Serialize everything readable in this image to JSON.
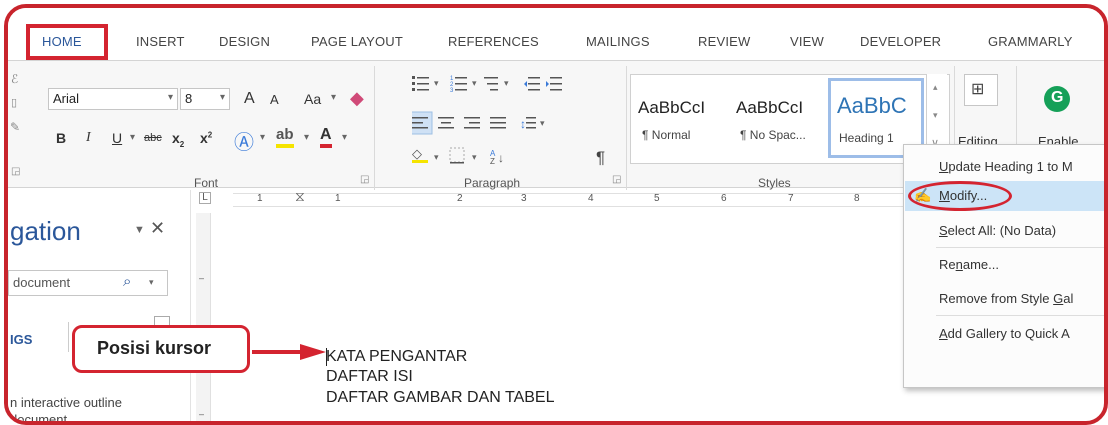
{
  "tabs": [
    "HOME",
    "INSERT",
    "DESIGN",
    "PAGE LAYOUT",
    "REFERENCES",
    "MAILINGS",
    "REVIEW",
    "VIEW",
    "DEVELOPER",
    "GRAMMARLY"
  ],
  "font": {
    "name": "Arial",
    "size": "8",
    "grow": "A",
    "shrink": "A",
    "case": "Aa",
    "bold": "B",
    "italic": "I",
    "underline": "U",
    "strike": "abc",
    "sub": "x",
    "sup": "x",
    "group_label": "Font"
  },
  "paragraph": {
    "group_label": "Paragraph",
    "pilcrow": "¶"
  },
  "styles": {
    "group_label": "Styles",
    "items": [
      {
        "sample": "AaBbCcI",
        "name": "¶ Normal"
      },
      {
        "sample": "AaBbCcI",
        "name": "¶ No Spac..."
      },
      {
        "sample": "AaBbC",
        "name": "Heading 1"
      }
    ]
  },
  "editing": {
    "label": "Editing"
  },
  "grammarly": {
    "label": "Enable",
    "icon_color": "#15a058"
  },
  "ruler": {
    "marks": [
      "1",
      "1",
      "2",
      "3",
      "4",
      "5",
      "6",
      "7",
      "8"
    ]
  },
  "nav": {
    "title": "gation",
    "search_placeholder": "document",
    "section_label": "IGS",
    "text_line1": "n interactive outline",
    "text_line2": "document"
  },
  "menu": {
    "items": [
      {
        "label": "Update Heading 1 to M",
        "u": "U",
        "rest": "pdate Heading 1 to M"
      },
      {
        "label": "Modify...",
        "u": "M",
        "rest": "odify..."
      },
      {
        "label": "Select All: (No Data)",
        "u": "S",
        "rest": "elect All: (No Data)"
      },
      {
        "label": "Rename...",
        "pre": "Re",
        "u": "n",
        "rest": "ame..."
      },
      {
        "label": "Remove from Style Gal",
        "pre": "Remove from Style ",
        "u": "G",
        "rest": "al"
      },
      {
        "label": "Add Gallery to Quick A",
        "u": "A",
        "rest": "dd Gallery to Quick A"
      }
    ]
  },
  "callout": {
    "text": "Posisi kursor"
  },
  "document": {
    "lines": [
      "KATA PENGANTAR",
      "DAFTAR ISI",
      "DAFTAR GAMBAR DAN TABEL"
    ]
  },
  "colors": {
    "accent_red": "#d42430",
    "word_blue": "#2b579a",
    "highlight": "#cce4f7"
  }
}
